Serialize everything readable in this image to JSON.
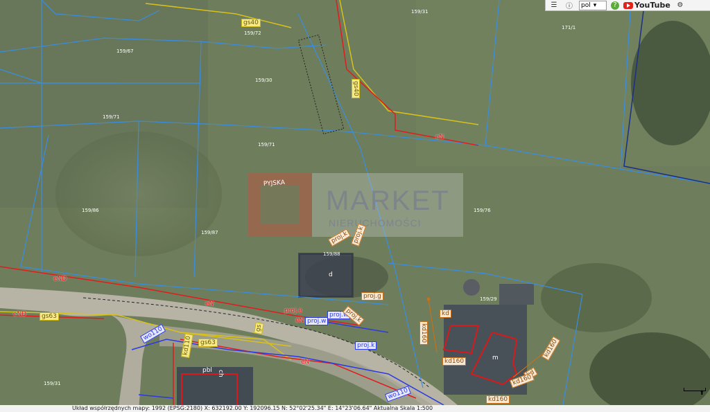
{
  "toolbar": {
    "legend_icon": "legend-icon",
    "info_icon": "info-icon",
    "language": "pol",
    "help_icon": "help-icon",
    "youtube_label": "YouTube",
    "settings_icon": "settings-icon"
  },
  "watermark": {
    "brand_line1": "MARKET",
    "brand_line2": "NIERUCHOMOŚCI"
  },
  "street_label": "PYJSKA",
  "parcel_numbers": [
    "159/31",
    "159/72",
    "171/1",
    "159/67",
    "159/30",
    "159/71",
    "159/71",
    "159/86",
    "159/87",
    "159/76",
    "159/88",
    "159/29",
    "159/31"
  ],
  "utility_labels": [
    "gs40",
    "gs40",
    "eN",
    "eND",
    "eN",
    "eND",
    "gs63",
    "proj.e",
    "eN",
    "proj.w",
    "proj.k",
    "proj.k",
    "proj.g",
    "proj.w",
    "wo110",
    "gs63",
    "kd110",
    "wo110",
    "eN",
    "proj.k",
    "proj.k",
    "kd",
    "kd160",
    "kd160",
    "kd160",
    "kd",
    "kd160",
    "kd160",
    "kd160",
    "pbl",
    "d",
    "m",
    "ch",
    "gs"
  ],
  "statusbar": {
    "text": "Układ współrzędnych mapy: 1992 (EPSG:2180)  X: 632192.00  Y: 192096.15  N: 52°02'25.34\"  E: 14°23'06.64\"  Aktualna Skala 1:500"
  },
  "colors": {
    "parcel": "#3a8ee0",
    "power": "#e21c1c",
    "gas": "#d8c21a",
    "water": "#2c3ae0",
    "sewer": "#c8701a"
  }
}
